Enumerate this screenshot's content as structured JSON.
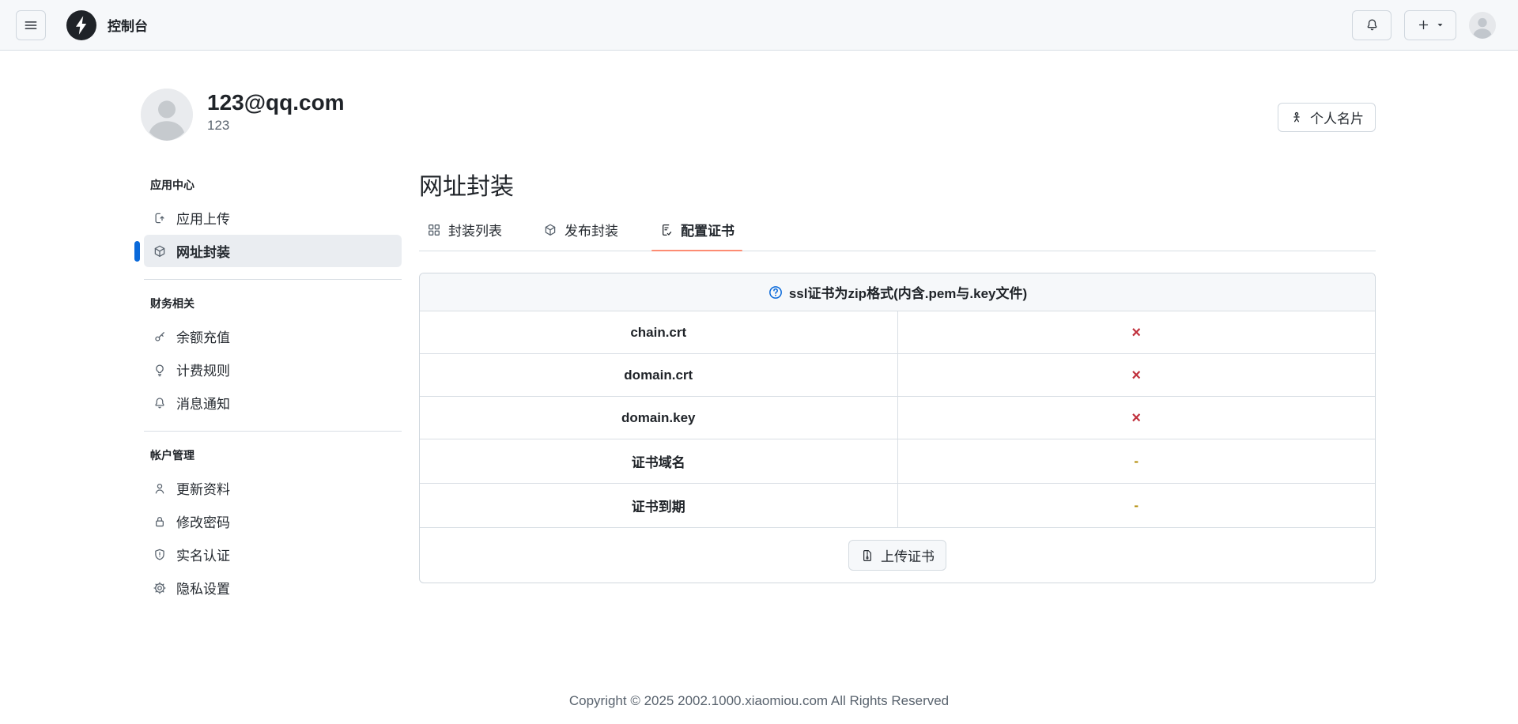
{
  "header": {
    "title": "控制台"
  },
  "profile": {
    "email": "123@qq.com",
    "username": "123",
    "card_button_label": "个人名片"
  },
  "sidebar": {
    "sections": [
      {
        "title": "应用中心",
        "items": [
          {
            "label": "应用上传"
          },
          {
            "label": "网址封装"
          }
        ]
      },
      {
        "title": "财务相关",
        "items": [
          {
            "label": "余额充值"
          },
          {
            "label": "计费规则"
          },
          {
            "label": "消息通知"
          }
        ]
      },
      {
        "title": "帐户管理",
        "items": [
          {
            "label": "更新资料"
          },
          {
            "label": "修改密码"
          },
          {
            "label": "实名认证"
          },
          {
            "label": "隐私设置"
          }
        ]
      }
    ]
  },
  "main": {
    "title": "网址封装",
    "tabs": [
      {
        "label": "封装列表"
      },
      {
        "label": "发布封装"
      },
      {
        "label": "配置证书"
      }
    ],
    "panel": {
      "notice": "ssl证书为zip格式(内含.pem与.key文件)",
      "rows": [
        {
          "label": "chain.crt",
          "value": "×"
        },
        {
          "label": "domain.crt",
          "value": "×"
        },
        {
          "label": "domain.key",
          "value": "×"
        },
        {
          "label": "证书域名",
          "value": "-"
        },
        {
          "label": "证书到期",
          "value": "-"
        }
      ],
      "upload_button_label": "上传证书"
    }
  },
  "footer": {
    "copyright": "Copyright © 2025 2002.1000.xiaomiou.com All Rights Reserved"
  },
  "colors": {
    "accent_blue": "#0969da",
    "tab_underline": "#fd8c73",
    "missing_red": "#c0303c",
    "empty_yellow": "#b08800"
  }
}
